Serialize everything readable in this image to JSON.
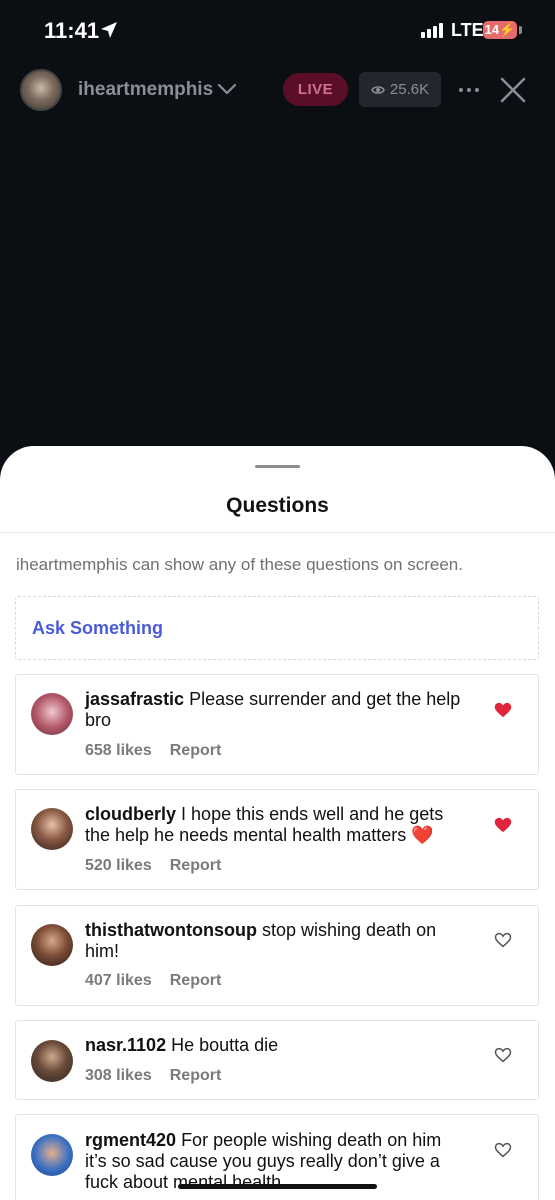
{
  "status_bar": {
    "time": "11:41",
    "network": "LTE",
    "battery": "14"
  },
  "live_header": {
    "host": "iheartmemphis",
    "live_label": "LIVE",
    "viewers": "25.6K"
  },
  "sheet": {
    "title": "Questions",
    "subtitle": "iheartmemphis can show any of these questions on screen.",
    "ask_label": "Ask Something",
    "report_label": "Report",
    "questions": [
      {
        "username": "jassafrastic",
        "text": "Please surrender and get the help bro",
        "likes": "658 likes",
        "liked": true
      },
      {
        "username": "cloudberly",
        "text": "I hope this ends well and he gets the help he needs mental health matters ❤️",
        "likes": "520 likes",
        "liked": true
      },
      {
        "username": "thisthatwontonsoup",
        "text": "stop wishing death on him!",
        "likes": "407 likes",
        "liked": false
      },
      {
        "username": "nasr.1102",
        "text": "He boutta die",
        "likes": "308 likes",
        "liked": false
      },
      {
        "username": "rgment420",
        "text": "For people wishing death on him it’s so sad cause you guys really don’t give a fuck about mental health",
        "likes": "",
        "liked": false
      }
    ]
  },
  "colors": {
    "accent": "#4a5bd8",
    "liked_heart": "#e0243c",
    "live_badge": "#5a0e28"
  }
}
